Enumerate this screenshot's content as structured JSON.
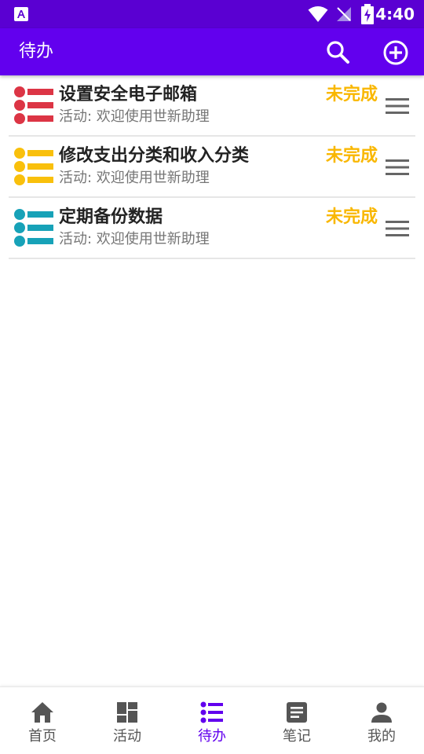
{
  "status_bar": {
    "time": "4:40",
    "icons": [
      "accessibility-a-icon",
      "wifi-icon",
      "no-signal-icon",
      "battery-charging-icon"
    ]
  },
  "app_bar": {
    "title": "待办",
    "actions": [
      "search-icon",
      "add-circle-icon"
    ]
  },
  "todos": [
    {
      "title": "设置安全电子邮箱",
      "subtitle": "活动: 欢迎使用世新助理",
      "status": "未完成",
      "icon_color": "#dc3545"
    },
    {
      "title": "修改支出分类和收入分类",
      "subtitle": "活动: 欢迎使用世新助理",
      "status": "未完成",
      "icon_color": "#f9c00c"
    },
    {
      "title": "定期备份数据",
      "subtitle": "活动: 欢迎使用世新助理",
      "status": "未完成",
      "icon_color": "#17a2b8"
    }
  ],
  "colors": {
    "status_bar": "#5a00d2",
    "app_bar": "#6200ee",
    "status_text": "#f9b700",
    "nav_active": "#6200ee",
    "nav_inactive": "#555555"
  },
  "bottom_nav": {
    "items": [
      {
        "label": "首页",
        "icon": "home-icon",
        "active": false
      },
      {
        "label": "活动",
        "icon": "dashboard-icon",
        "active": false
      },
      {
        "label": "待办",
        "icon": "list-icon",
        "active": true
      },
      {
        "label": "笔记",
        "icon": "note-icon",
        "active": false
      },
      {
        "label": "我的",
        "icon": "person-icon",
        "active": false
      }
    ]
  }
}
